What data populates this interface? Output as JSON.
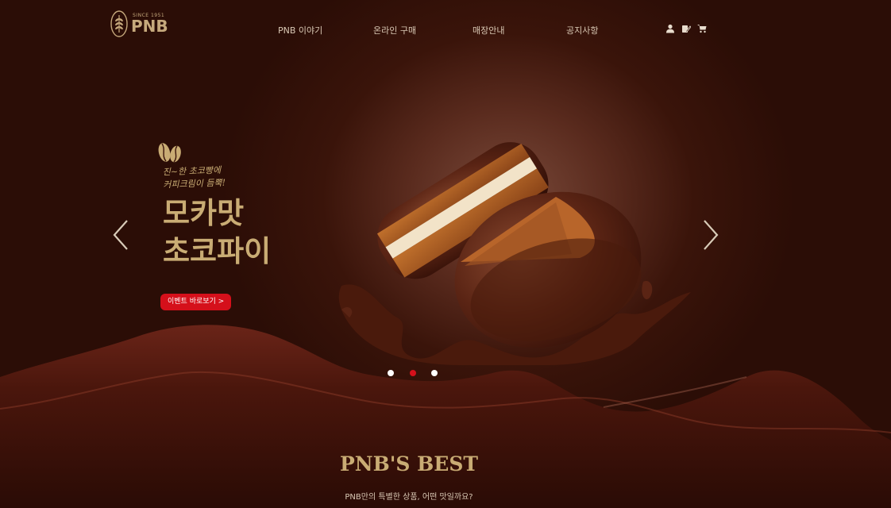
{
  "header": {
    "logo_since": "SINCE 1951",
    "logo_name": "PNB",
    "nav": [
      "PNB 이야기",
      "온라인 구매",
      "매장안내",
      "공지사항"
    ],
    "icons": [
      "user-icon",
      "edit-icon",
      "cart-icon"
    ]
  },
  "hero": {
    "tagline_line1": "진~한 초코빵에",
    "tagline_line2": "커피크림이 듬뿍!",
    "title_line1": "모카맛",
    "title_line2": "초코파이",
    "cta_label": "이벤트 바로보기 >",
    "slide_count": 3,
    "active_slide": 2
  },
  "best": {
    "title": "PNB'S BEST",
    "subtitle": "PNB만의 특별한 상품, 어떤 맛일까요?"
  },
  "colors": {
    "background": "#2a0d06",
    "gold": "#c9ac74",
    "accent_red": "#d5101b"
  }
}
